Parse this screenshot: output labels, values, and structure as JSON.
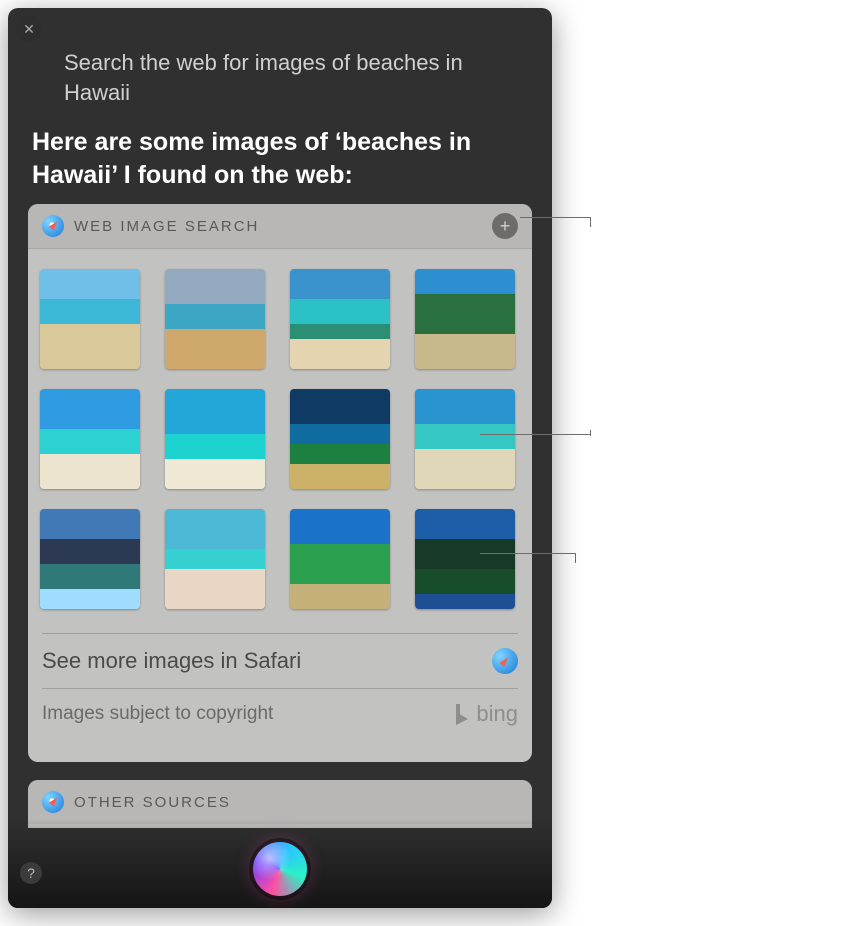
{
  "close_glyph": "✕",
  "user_query": "Search the web for images of beaches in Hawaii",
  "siri_reply": "Here are some images of ‘beaches in Hawaii’ I found on the web:",
  "web_card": {
    "title": "WEB IMAGE SEARCH",
    "add_glyph": "+",
    "see_more": "See more images in Safari",
    "copyright": "Images subject to copyright",
    "provider": "bing",
    "thumb_count": 12
  },
  "other_card": {
    "title": "OTHER SOURCES"
  },
  "help_glyph": "?"
}
